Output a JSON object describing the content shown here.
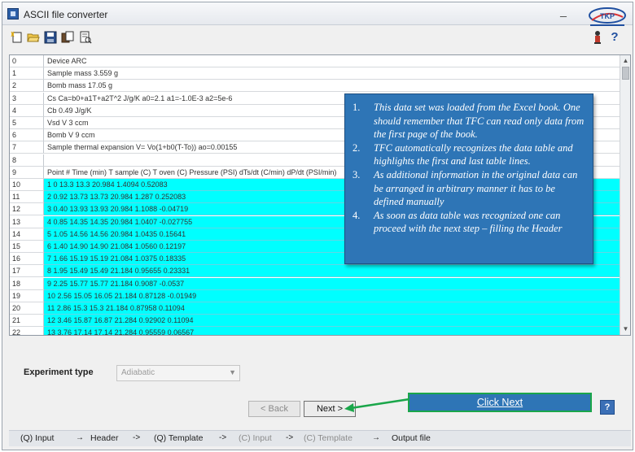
{
  "window": {
    "title": "ASCII file converter"
  },
  "toolbar": {
    "icons": [
      "new-icon",
      "open-folder-icon",
      "save-icon",
      "copy-icon",
      "preview-icon"
    ],
    "help_glyph": "?"
  },
  "grid": {
    "rows": [
      {
        "index": "0",
        "text": "Device ARC",
        "highlight": false
      },
      {
        "index": "1",
        "text": "Sample mass 3.559 g",
        "highlight": false
      },
      {
        "index": "2",
        "text": "Bomb mass 17.05 g",
        "highlight": false
      },
      {
        "index": "3",
        "text": "Cs Ca=b0+a1T+a2T^2 J/g/K a0=2.1 a1=-1.0E-3 a2=5e-6",
        "highlight": false
      },
      {
        "index": "4",
        "text": "Cb 0.49 J/g/K",
        "highlight": false
      },
      {
        "index": "5",
        "text": "Vsd V 3 ccm",
        "highlight": false
      },
      {
        "index": "6",
        "text": "Bomb V 9 ccm",
        "highlight": false
      },
      {
        "index": "7",
        "text": "Sample thermal expansion V= Vo(1+b0(T-To)) ao=0.00155",
        "highlight": false
      },
      {
        "index": "8",
        "text": "",
        "highlight": false
      },
      {
        "index": "9",
        "text": "Point # Time (min) T sample (C) T oven (C) Pressure (PSI) dTs/dt (C/min) dP/dt (PSI/min)",
        "highlight": false
      },
      {
        "index": "10",
        "text": "1 0 13.3 13.3 20.984 1.4094 0.52083",
        "highlight": true
      },
      {
        "index": "11",
        "text": "2 0.92 13.73 13.73 20.984 1.287 0.252083",
        "highlight": true
      },
      {
        "index": "12",
        "text": "3 0.40 13.93 13.93 20.984 1.1088 -0.04719",
        "highlight": true
      },
      {
        "index": "13",
        "text": "4 0.85 14.35 14.35 20.984 1.0407 -0.027755",
        "highlight": true
      },
      {
        "index": "14",
        "text": "5 1.05 14.56 14.56 20.984 1.0435 0.15641",
        "highlight": true
      },
      {
        "index": "15",
        "text": "6 1.40 14.90 14.90 21.084 1.0560 0.12197",
        "highlight": true
      },
      {
        "index": "16",
        "text": "7 1.66 15.19 15.19 21.084 1.0375 0.18335",
        "highlight": true
      },
      {
        "index": "17",
        "text": "8 1.95 15.49 15.49 21.184 0.95655 0.23331",
        "highlight": true
      },
      {
        "index": "18",
        "text": "9 2.25 15.77 15.77 21.184 0.9087 -0.0537",
        "highlight": true
      },
      {
        "index": "19",
        "text": "10 2.56 15.05 16.05 21.184 0.87128 -0.01949",
        "highlight": true
      },
      {
        "index": "20",
        "text": "11 2.86 15.3 15.3 21.184 0.87958 0.11094",
        "highlight": true
      },
      {
        "index": "21",
        "text": "12 3.46 15.87 16.87 21.284 0.92902 0.11094",
        "highlight": true
      },
      {
        "index": "22",
        "text": "13 3.76 17.14 17.14 21.284 0.95559 0.06567",
        "highlight": true
      }
    ]
  },
  "callout": {
    "items": [
      {
        "num": "1.",
        "text": "This data set was loaded from the Excel book. One should remember that TFC can read only data from the first page of the book."
      },
      {
        "num": "2.",
        "text": "TFC automatically recognizes the data table and highlights the first and last table lines."
      },
      {
        "num": "3.",
        "text": "As additional information in the original data can be arranged in arbitrary manner it has to be defined manually"
      },
      {
        "num": "4.",
        "text": "As soon as data table was recognized one can proceed with the next step – filling the Header"
      }
    ]
  },
  "experiment": {
    "label": "Experiment type",
    "value": "Adiabatic"
  },
  "buttons": {
    "back": "< Back",
    "next": "Next >",
    "help": "?"
  },
  "annotation": {
    "click_next": "Click Next"
  },
  "steps": {
    "items": [
      {
        "label": "(Q) Input",
        "muted": false
      },
      {
        "label": "Header",
        "muted": false
      },
      {
        "label": "(Q) Template",
        "muted": false
      },
      {
        "label": "(C) Input",
        "muted": true
      },
      {
        "label": "(C) Template",
        "muted": true
      },
      {
        "label": "Output file",
        "muted": false
      }
    ],
    "arrows": [
      "→",
      "->",
      "->",
      "->",
      "→"
    ]
  },
  "colors": {
    "highlight": "#00ffff",
    "callout": "#2e75b6",
    "annotation_border": "#1aa64a"
  }
}
